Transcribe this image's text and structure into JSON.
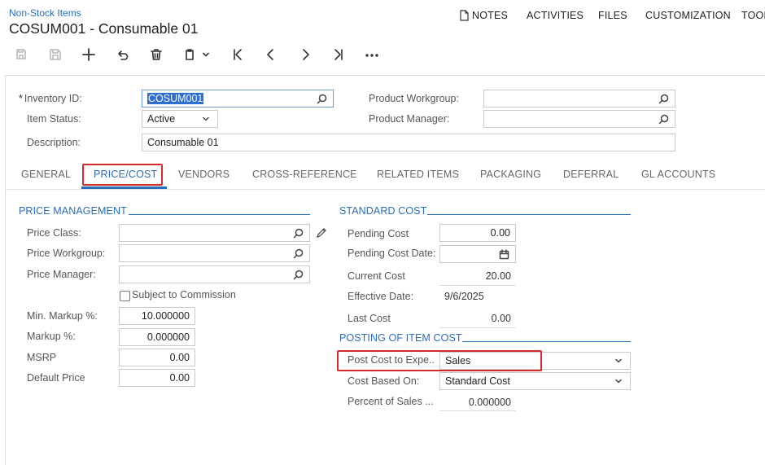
{
  "header": {
    "breadcrumb": "Non-Stock Items",
    "title": "COSUM001 - Consumable 01",
    "menu": {
      "notes": "NOTES",
      "activities": "ACTIVITIES",
      "files": "FILES",
      "customization": "CUSTOMIZATION",
      "tools": "TOOL"
    }
  },
  "form": {
    "inventory_id": {
      "label": "Inventory ID:",
      "required": "*",
      "value": "COSUM001"
    },
    "item_status": {
      "label": "Item Status:",
      "value": "Active"
    },
    "description": {
      "label": "Description:",
      "value": "Consumable 01"
    },
    "product_workgroup": {
      "label": "Product Workgroup:",
      "value": ""
    },
    "product_manager": {
      "label": "Product Manager:",
      "value": ""
    }
  },
  "tabs": [
    {
      "label": "GENERAL"
    },
    {
      "label": "PRICE/COST"
    },
    {
      "label": "VENDORS"
    },
    {
      "label": "CROSS-REFERENCE"
    },
    {
      "label": "RELATED ITEMS"
    },
    {
      "label": "PACKAGING"
    },
    {
      "label": "DEFERRAL"
    },
    {
      "label": "GL ACCOUNTS"
    }
  ],
  "active_tab": "PRICE/COST",
  "price_management": {
    "title": "PRICE MANAGEMENT",
    "price_class": {
      "label": "Price Class:",
      "value": ""
    },
    "price_workgroup": {
      "label": "Price Workgroup:",
      "value": ""
    },
    "price_manager": {
      "label": "Price Manager:",
      "value": ""
    },
    "subject_to_commission": {
      "label": "Subject to Commission",
      "checked": false
    },
    "min_markup": {
      "label": "Min. Markup %:",
      "value": "10.000000"
    },
    "markup": {
      "label": "Markup %:",
      "value": "0.000000"
    },
    "msrp": {
      "label": "MSRP",
      "value": "0.00"
    },
    "default_price": {
      "label": "Default Price",
      "value": "0.00"
    }
  },
  "standard_cost": {
    "title": "STANDARD COST",
    "pending_cost": {
      "label": "Pending Cost",
      "value": "0.00"
    },
    "pending_cost_date": {
      "label": "Pending Cost Date:",
      "value": ""
    },
    "current_cost": {
      "label": "Current Cost",
      "value": "20.00"
    },
    "effective_date": {
      "label": "Effective Date:",
      "value": "9/6/2025"
    },
    "last_cost": {
      "label": "Last Cost",
      "value": "0.00"
    }
  },
  "posting": {
    "title": "POSTING OF ITEM COST",
    "post_cost_to_expense": {
      "label": "Post Cost to Expe...",
      "value": "Sales"
    },
    "cost_based_on": {
      "label": "Cost Based On:",
      "value": "Standard Cost"
    },
    "percent_of_sales": {
      "label": "Percent of Sales ...",
      "value": "0.000000"
    }
  },
  "colors": {
    "accent": "#2a6ebb",
    "highlight_box": "#d62b2b",
    "selection": "#2f6fd1"
  }
}
